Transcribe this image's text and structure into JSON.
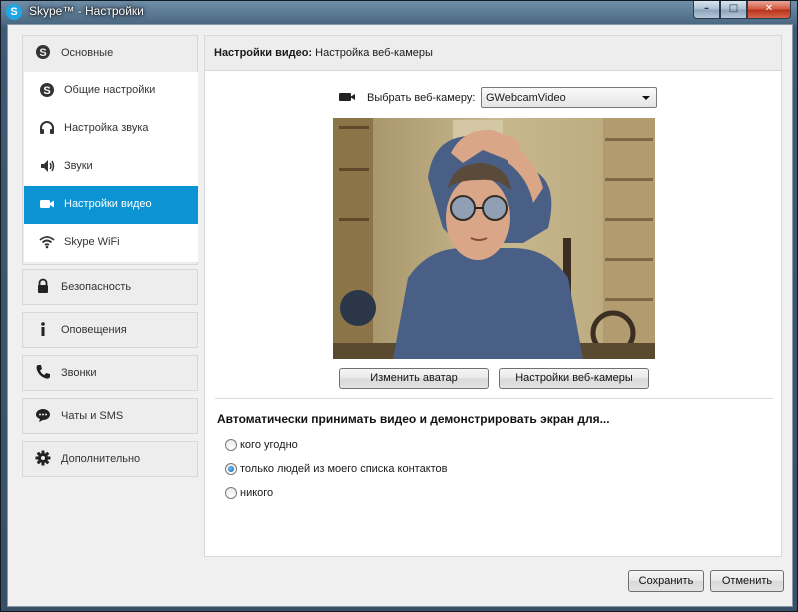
{
  "window": {
    "title": "Skype™ - Настройки",
    "app_icon_letter": "S",
    "controls": {
      "minimize": "–",
      "maximize": "□",
      "close": "✕"
    }
  },
  "sidebar": {
    "main_group": {
      "label": "Основные",
      "icon": "skype-icon",
      "items": [
        {
          "label": "Общие настройки",
          "icon": "skype-icon"
        },
        {
          "label": "Настройка звука",
          "icon": "headset-icon"
        },
        {
          "label": "Звуки",
          "icon": "speaker-icon"
        },
        {
          "label": "Настройки видео",
          "icon": "video-camera-icon",
          "active": true
        },
        {
          "label": "Skype WiFi",
          "icon": "wifi-icon"
        }
      ]
    },
    "groups": [
      {
        "label": "Безопасность",
        "icon": "lock-icon"
      },
      {
        "label": "Оповещения",
        "icon": "info-icon"
      },
      {
        "label": "Звонки",
        "icon": "phone-icon"
      },
      {
        "label": "Чаты и SMS",
        "icon": "chat-icon"
      },
      {
        "label": "Дополнительно",
        "icon": "gear-icon"
      }
    ]
  },
  "panel": {
    "header_bold": "Настройки видео:",
    "header_rest": " Настройка веб-камеры",
    "webcam_label": "Выбрать веб-камеру:",
    "webcam_value": "GWebcamVideo",
    "change_avatar_button": "Изменить аватар",
    "webcam_settings_button": "Настройки веб-камеры",
    "auto_accept_title": "Автоматически принимать видео и демонстрировать экран для...",
    "auto_accept_options": [
      {
        "label": "кого угодно",
        "checked": false
      },
      {
        "label": "только людей из моего списка контактов",
        "checked": true
      },
      {
        "label": "никого",
        "checked": false
      }
    ]
  },
  "footer": {
    "save_button": "Сохранить",
    "cancel_button": "Отменить"
  },
  "colors": {
    "accent": "#0b93d3",
    "sidebar_bg": "#ededed"
  }
}
